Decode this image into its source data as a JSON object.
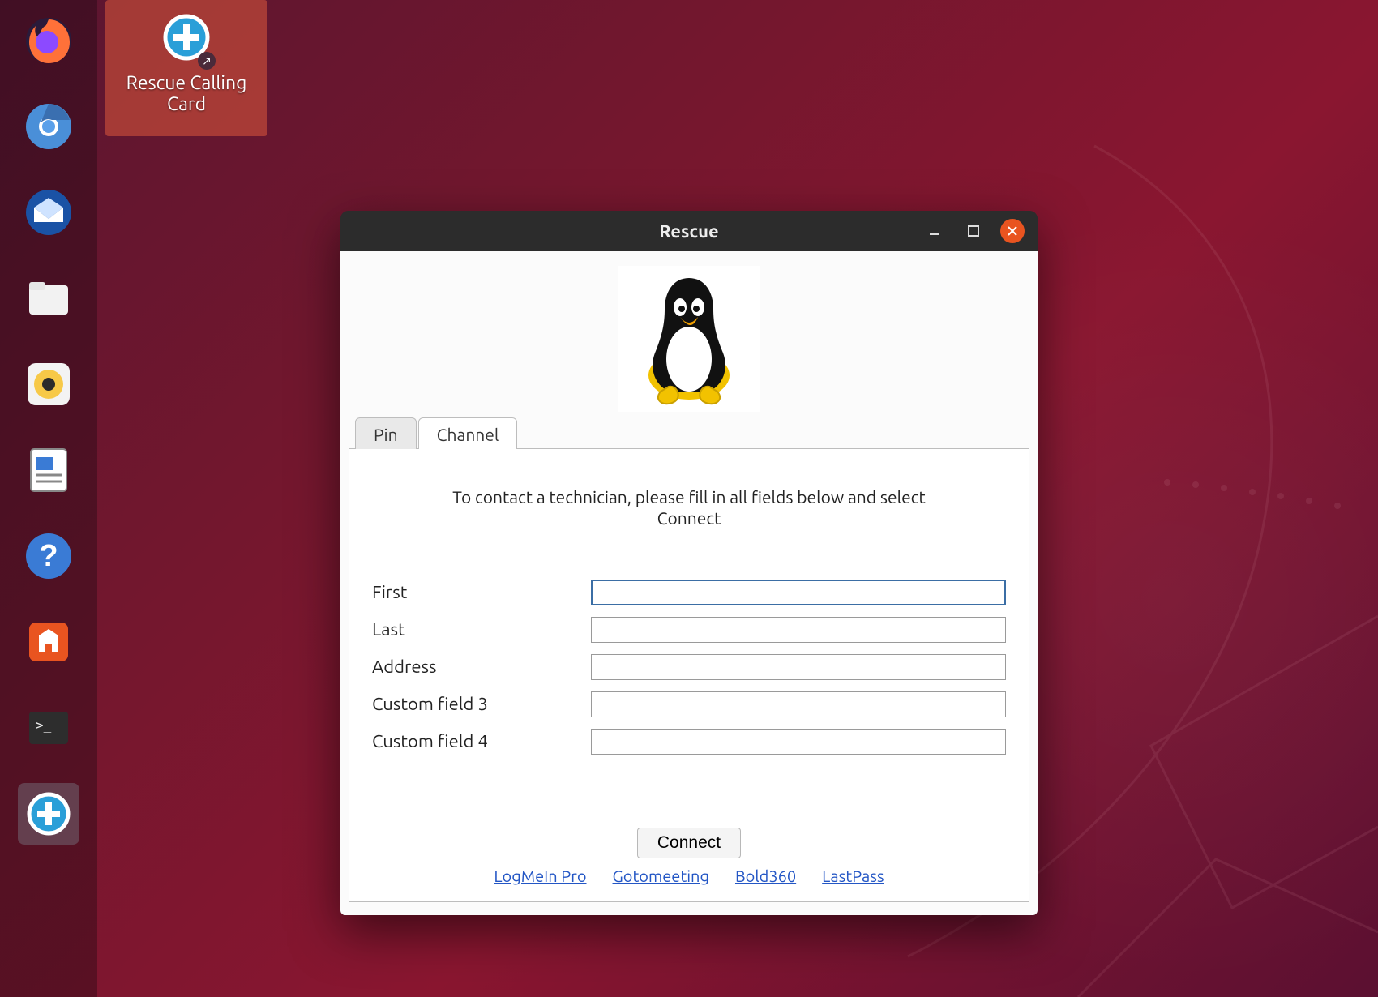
{
  "desktop": {
    "shortcut": {
      "label": "Rescue Calling Card",
      "icon": "rescue-plus-icon"
    }
  },
  "dock": {
    "items": [
      {
        "name": "firefox-icon"
      },
      {
        "name": "chromium-icon"
      },
      {
        "name": "thunderbird-icon"
      },
      {
        "name": "files-icon"
      },
      {
        "name": "rhythmbox-icon"
      },
      {
        "name": "libreoffice-writer-icon"
      },
      {
        "name": "help-icon"
      },
      {
        "name": "ubuntu-software-icon"
      },
      {
        "name": "terminal-icon"
      },
      {
        "name": "rescue-icon"
      }
    ]
  },
  "window": {
    "title": "Rescue",
    "tabs": [
      {
        "id": "pin",
        "label": "Pin",
        "active": false
      },
      {
        "id": "channel",
        "label": "Channel",
        "active": true
      }
    ],
    "instruction": "To contact a technician, please fill in all fields below and select Connect",
    "form": {
      "fields": [
        {
          "id": "first",
          "label": "First",
          "value": "",
          "focused": true
        },
        {
          "id": "last",
          "label": "Last",
          "value": "",
          "focused": false
        },
        {
          "id": "address",
          "label": "Address",
          "value": "",
          "focused": false
        },
        {
          "id": "custom3",
          "label": "Custom field 3",
          "value": "",
          "focused": false
        },
        {
          "id": "custom4",
          "label": "Custom field 4",
          "value": "",
          "focused": false
        }
      ]
    },
    "connect_label": "Connect",
    "footer_links": [
      {
        "label": "LogMeIn Pro"
      },
      {
        "label": "Gotomeeting"
      },
      {
        "label": "Bold360"
      },
      {
        "label": "LastPass"
      }
    ]
  },
  "colors": {
    "ubuntu_orange": "#e95420",
    "link_blue": "#2356c5"
  }
}
